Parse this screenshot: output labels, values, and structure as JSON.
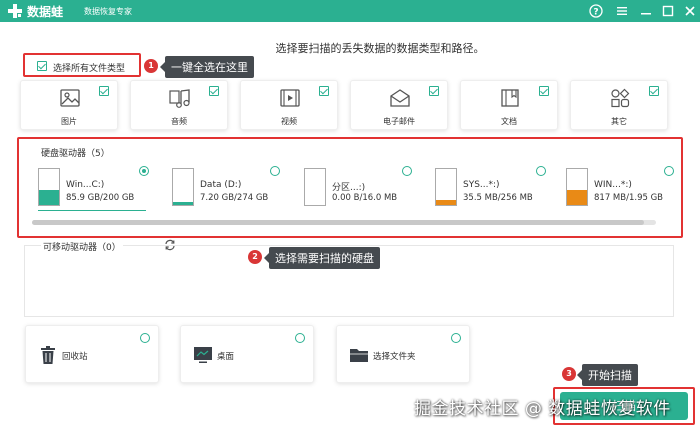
{
  "app": {
    "name": "数据蛙",
    "subtitle": "数据恢复专家"
  },
  "window_controls": [
    "help-icon",
    "menu-icon",
    "minimize-icon",
    "maximize-icon",
    "close-icon"
  ],
  "header": {
    "title": "选择要扫描的丢失数据的数据类型和路径。"
  },
  "select_all": {
    "label": "选择所有文件类型",
    "checked": true
  },
  "annotations": [
    {
      "number": "1",
      "text": "一键全选在这里"
    },
    {
      "number": "2",
      "text": "选择需要扫描的硬盘"
    },
    {
      "number": "3",
      "text": "开始扫描"
    }
  ],
  "file_types": [
    {
      "label": "图片",
      "icon": "image-icon",
      "checked": true
    },
    {
      "label": "音频",
      "icon": "music-icon",
      "checked": true
    },
    {
      "label": "视频",
      "icon": "video-icon",
      "checked": true
    },
    {
      "label": "电子邮件",
      "icon": "email-icon",
      "checked": true
    },
    {
      "label": "文档",
      "icon": "document-icon",
      "checked": true
    },
    {
      "label": "其它",
      "icon": "other-icon",
      "checked": true
    }
  ],
  "hard_drives": {
    "title": "硬盘驱动器（5）",
    "items": [
      {
        "name": "Win...C:)",
        "size": "85.9 GB/200 GB",
        "used_fraction": 0.43,
        "fill": "#2bb091",
        "selected": true
      },
      {
        "name": "Data (D:)",
        "size": "7.20 GB/274 GB",
        "used_fraction": 0.03,
        "fill": "#2bb091",
        "selected": false
      },
      {
        "name": "分区...:)",
        "size": "0.00  B/16.0 MB",
        "used_fraction": 0.0,
        "fill": "#e98a16",
        "selected": false
      },
      {
        "name": "SYS...*:)",
        "size": "35.5 MB/256 MB",
        "used_fraction": 0.14,
        "fill": "#e98a16",
        "selected": false
      },
      {
        "name": "WIN...*:)",
        "size": "817 MB/1.95 GB",
        "used_fraction": 0.42,
        "fill": "#e98a16",
        "selected": false
      }
    ]
  },
  "removable": {
    "title": "可移动驱动器（0）",
    "refresh_icon": "refresh-icon"
  },
  "locations": [
    {
      "label": "回收站",
      "icon": "trash-icon"
    },
    {
      "label": "桌面",
      "icon": "desktop-icon"
    },
    {
      "label": "选择文件夹",
      "icon": "folder-icon"
    }
  ],
  "scan_button": {
    "label": "扫描"
  },
  "watermark": "掘金技术社区 @ 数据蛙恢复软件",
  "colors": {
    "accent": "#2bb091",
    "annotation_red": "#e23232",
    "callout_bg": "#454a4f",
    "warning": "#e98a16"
  }
}
